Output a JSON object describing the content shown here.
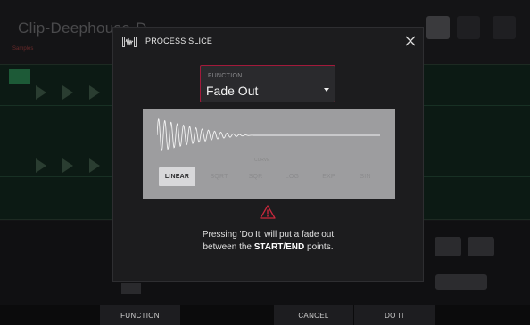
{
  "background": {
    "title": "Clip-Deephouse-D",
    "subtitle": "Samples"
  },
  "modal": {
    "title": "PROCESS SLICE",
    "function_label": "FUNCTION",
    "function_value": "Fade Out",
    "curve_caption": "CURVE",
    "curve_types": [
      "LINEAR",
      "SQRT",
      "SQR",
      "LOG",
      "EXP",
      "SIN"
    ],
    "selected_curve": "LINEAR",
    "message_prefix": "Pressing 'Do It' will put a fade out",
    "message_mid": "between the ",
    "message_bold": "START/END",
    "message_suffix": " points."
  },
  "footer": {
    "function": "FUNCTION",
    "cancel": "CANCEL",
    "do_it": "DO IT"
  },
  "colors": {
    "accent_border": "#a21a3b",
    "warning": "#c8283c"
  },
  "icons": {
    "header": "waveform-icon",
    "close": "close-icon",
    "warning": "warning-icon",
    "dropdown": "chevron-down-icon"
  }
}
